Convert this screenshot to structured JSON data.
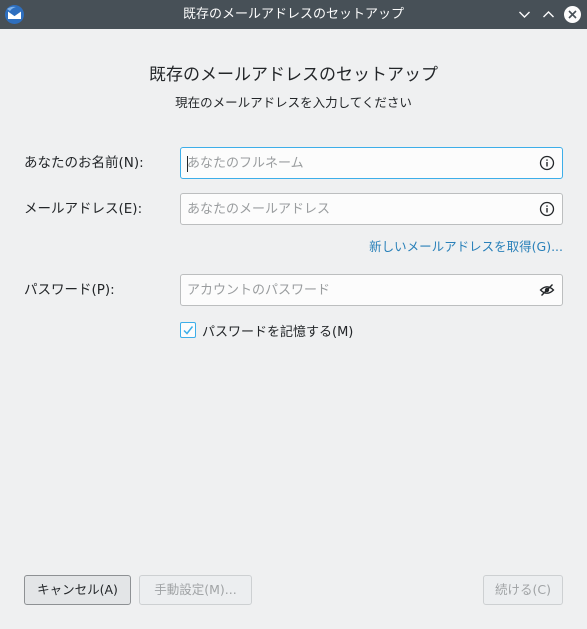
{
  "window": {
    "title": "既存のメールアドレスのセットアップ"
  },
  "header": {
    "title": "既存のメールアドレスのセットアップ",
    "subtitle": "現在のメールアドレスを入力してください"
  },
  "form": {
    "name": {
      "label": "あなたのお名前(N):",
      "value": "",
      "placeholder": "あなたのフルネーム",
      "icon": "info-icon"
    },
    "email": {
      "label": "メールアドレス(E):",
      "value": "",
      "placeholder": "あなたのメールアドレス",
      "icon": "info-icon"
    },
    "get_new_email_link": "新しいメールアドレスを取得(G)...",
    "password": {
      "label": "パスワード(P):",
      "value": "",
      "placeholder": "アカウントのパスワード",
      "icon": "eye-slash-icon"
    },
    "remember_password": {
      "label": "パスワードを記憶する(M)",
      "checked": true
    }
  },
  "buttons": {
    "cancel": "キャンセル(A)",
    "manual": "手動設定(M)...",
    "continue": "続ける(C)"
  },
  "colors": {
    "titlebar": "#475057",
    "accent": "#3daee9",
    "link": "#2980b9",
    "background": "#eff0f1"
  }
}
